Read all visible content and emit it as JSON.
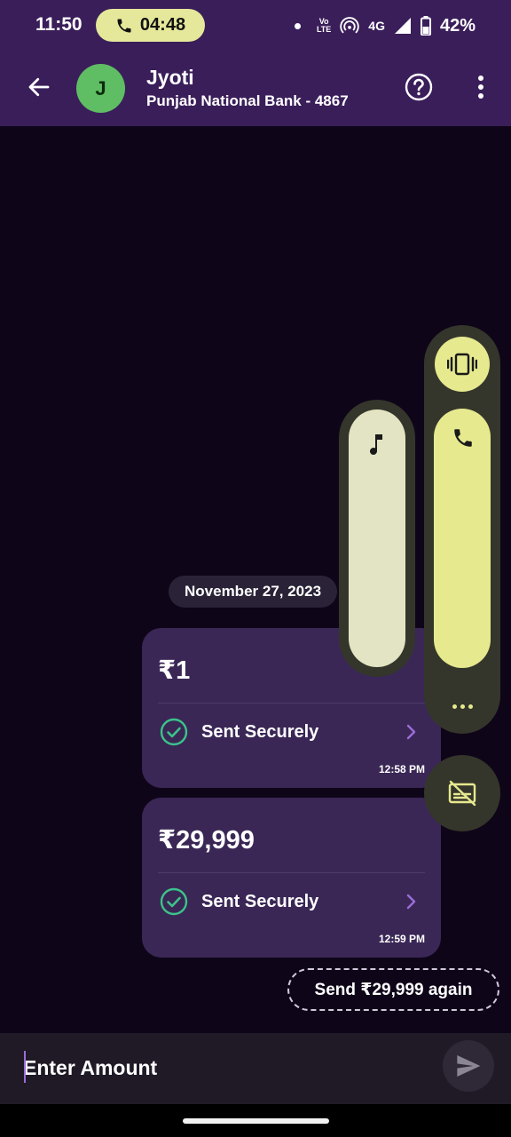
{
  "status_bar": {
    "time": "11:50",
    "call_timer": "04:48",
    "volte_top": "Vo",
    "volte_bottom": "LTE",
    "network": "4G",
    "battery": "42%"
  },
  "header": {
    "avatar_initial": "J",
    "name": "Jyoti",
    "subtitle": "Punjab National Bank - 4867",
    "avatar_color": "#5fbd64"
  },
  "chat": {
    "date": "November 27, 2023",
    "messages": [
      {
        "amount": "₹1",
        "status": "Sent Securely",
        "time": "12:58 PM"
      },
      {
        "amount": "₹29,999",
        "status": "Sent Securely",
        "time": "12:59 PM"
      }
    ],
    "send_again": "Send ₹29,999 again"
  },
  "input": {
    "placeholder": "Enter Amount"
  },
  "colors": {
    "header_bg": "#3a1e5a",
    "bubble_bg": "#3a2756",
    "success": "#3cc28a",
    "accent": "#9b6dd6"
  }
}
